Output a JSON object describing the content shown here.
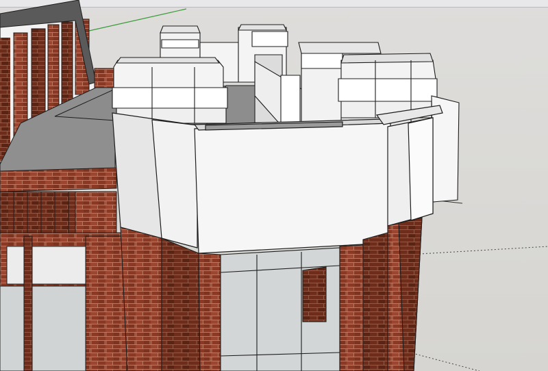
{
  "window": {
    "view": "3d-model-viewport"
  },
  "colors": {
    "brick": "#8a3a24",
    "brick_dark": "#5e2615",
    "mortar": "#b07055",
    "white_face": "#f4f4f4",
    "white_shade": "#dcdcdc",
    "roof": "#8f8f8f",
    "glass": "#d4d8d8",
    "axis_green": "#3a9a3a",
    "edge": "#1d1d1d"
  },
  "icons": [
    "green-axis-line",
    "dashed-guide-line"
  ]
}
